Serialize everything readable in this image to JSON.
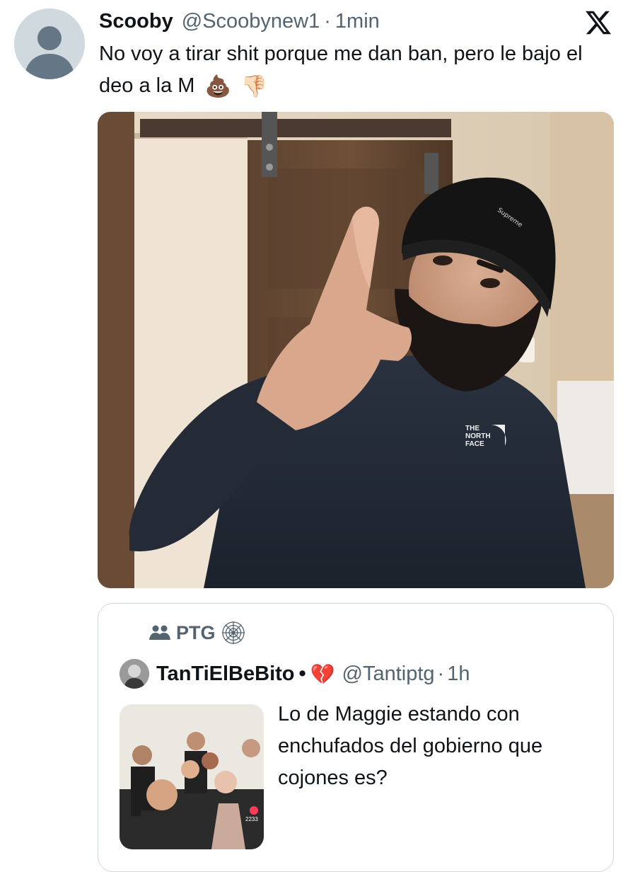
{
  "tweet": {
    "display_name": "Scooby",
    "handle": "@Scoobynew1",
    "separator": "·",
    "time": "1min",
    "text": "No voy a tirar shit porque me dan ban, pero le bajo el deo a la M",
    "emojis": [
      "💩",
      "👎🏻"
    ]
  },
  "media": {
    "beanie_text": "Supreme",
    "logo_text": [
      "THE",
      "NORTH",
      "FACE"
    ]
  },
  "quote": {
    "community": "PTG",
    "display_name": "TanTiElBeBito",
    "bullet": "•",
    "emoji": "💔",
    "handle": "@Tantiptg",
    "separator": "·",
    "time": "1h",
    "text": "Lo de Maggie estando con enchufados del gobierno que cojones es?",
    "media_count": "2233"
  },
  "icons": [
    "user-avatar-placeholder-icon",
    "x-logo-icon",
    "poop-emoji-icon",
    "thumbs-down-emoji-icon",
    "community-icon",
    "spider-web-icon",
    "broken-heart-emoji-icon"
  ],
  "colors": {
    "text": "#0f1419",
    "secondary": "#536471",
    "border": "#cfd9de"
  }
}
